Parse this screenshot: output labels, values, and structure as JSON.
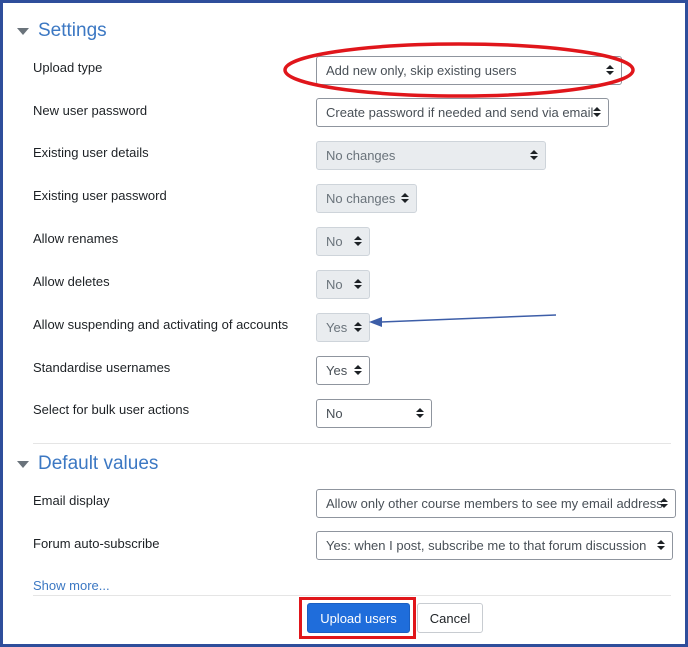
{
  "settings": {
    "title": "Settings",
    "fields": [
      {
        "label": "Upload type",
        "value": "Add new only, skip existing users",
        "disabled": false
      },
      {
        "label": "New user password",
        "value": "Create password if needed and send via email",
        "disabled": false
      },
      {
        "label": "Existing user details",
        "value": "No changes",
        "disabled": true
      },
      {
        "label": "Existing user password",
        "value": "No changes",
        "disabled": true
      },
      {
        "label": "Allow renames",
        "value": "No",
        "disabled": true
      },
      {
        "label": "Allow deletes",
        "value": "No",
        "disabled": true
      },
      {
        "label": "Allow suspending and activating of accounts",
        "value": "Yes",
        "disabled": true
      },
      {
        "label": "Standardise usernames",
        "value": "Yes",
        "disabled": false
      },
      {
        "label": "Select for bulk user actions",
        "value": "No",
        "disabled": false
      }
    ]
  },
  "defaults": {
    "title": "Default values",
    "fields": [
      {
        "label": "Email display",
        "value": "Allow only other course members to see my email address"
      },
      {
        "label": "Forum auto-subscribe",
        "value": "Yes: when I post, subscribe me to that forum discussion"
      }
    ],
    "show_more": "Show more..."
  },
  "actions": {
    "upload_label": "Upload users",
    "cancel_label": "Cancel"
  },
  "colors": {
    "accent": "#3c78c3",
    "primary_button": "#1f6ddb",
    "annotation_red": "#e0161b",
    "annotation_arrow": "#3d5ea8"
  },
  "icons": {
    "section_toggle": "collapse-triangle-icon",
    "select_caret": "up-down-caret-icon"
  }
}
